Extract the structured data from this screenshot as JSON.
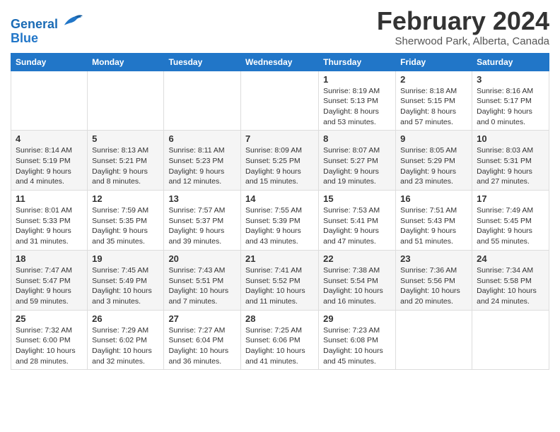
{
  "header": {
    "logo_line1": "General",
    "logo_line2": "Blue",
    "title": "February 2024",
    "subtitle": "Sherwood Park, Alberta, Canada"
  },
  "days_of_week": [
    "Sunday",
    "Monday",
    "Tuesday",
    "Wednesday",
    "Thursday",
    "Friday",
    "Saturday"
  ],
  "weeks": [
    [
      {
        "day": "",
        "info": ""
      },
      {
        "day": "",
        "info": ""
      },
      {
        "day": "",
        "info": ""
      },
      {
        "day": "",
        "info": ""
      },
      {
        "day": "1",
        "info": "Sunrise: 8:19 AM\nSunset: 5:13 PM\nDaylight: 8 hours and 53 minutes."
      },
      {
        "day": "2",
        "info": "Sunrise: 8:18 AM\nSunset: 5:15 PM\nDaylight: 8 hours and 57 minutes."
      },
      {
        "day": "3",
        "info": "Sunrise: 8:16 AM\nSunset: 5:17 PM\nDaylight: 9 hours and 0 minutes."
      }
    ],
    [
      {
        "day": "4",
        "info": "Sunrise: 8:14 AM\nSunset: 5:19 PM\nDaylight: 9 hours and 4 minutes."
      },
      {
        "day": "5",
        "info": "Sunrise: 8:13 AM\nSunset: 5:21 PM\nDaylight: 9 hours and 8 minutes."
      },
      {
        "day": "6",
        "info": "Sunrise: 8:11 AM\nSunset: 5:23 PM\nDaylight: 9 hours and 12 minutes."
      },
      {
        "day": "7",
        "info": "Sunrise: 8:09 AM\nSunset: 5:25 PM\nDaylight: 9 hours and 15 minutes."
      },
      {
        "day": "8",
        "info": "Sunrise: 8:07 AM\nSunset: 5:27 PM\nDaylight: 9 hours and 19 minutes."
      },
      {
        "day": "9",
        "info": "Sunrise: 8:05 AM\nSunset: 5:29 PM\nDaylight: 9 hours and 23 minutes."
      },
      {
        "day": "10",
        "info": "Sunrise: 8:03 AM\nSunset: 5:31 PM\nDaylight: 9 hours and 27 minutes."
      }
    ],
    [
      {
        "day": "11",
        "info": "Sunrise: 8:01 AM\nSunset: 5:33 PM\nDaylight: 9 hours and 31 minutes."
      },
      {
        "day": "12",
        "info": "Sunrise: 7:59 AM\nSunset: 5:35 PM\nDaylight: 9 hours and 35 minutes."
      },
      {
        "day": "13",
        "info": "Sunrise: 7:57 AM\nSunset: 5:37 PM\nDaylight: 9 hours and 39 minutes."
      },
      {
        "day": "14",
        "info": "Sunrise: 7:55 AM\nSunset: 5:39 PM\nDaylight: 9 hours and 43 minutes."
      },
      {
        "day": "15",
        "info": "Sunrise: 7:53 AM\nSunset: 5:41 PM\nDaylight: 9 hours and 47 minutes."
      },
      {
        "day": "16",
        "info": "Sunrise: 7:51 AM\nSunset: 5:43 PM\nDaylight: 9 hours and 51 minutes."
      },
      {
        "day": "17",
        "info": "Sunrise: 7:49 AM\nSunset: 5:45 PM\nDaylight: 9 hours and 55 minutes."
      }
    ],
    [
      {
        "day": "18",
        "info": "Sunrise: 7:47 AM\nSunset: 5:47 PM\nDaylight: 9 hours and 59 minutes."
      },
      {
        "day": "19",
        "info": "Sunrise: 7:45 AM\nSunset: 5:49 PM\nDaylight: 10 hours and 3 minutes."
      },
      {
        "day": "20",
        "info": "Sunrise: 7:43 AM\nSunset: 5:51 PM\nDaylight: 10 hours and 7 minutes."
      },
      {
        "day": "21",
        "info": "Sunrise: 7:41 AM\nSunset: 5:52 PM\nDaylight: 10 hours and 11 minutes."
      },
      {
        "day": "22",
        "info": "Sunrise: 7:38 AM\nSunset: 5:54 PM\nDaylight: 10 hours and 16 minutes."
      },
      {
        "day": "23",
        "info": "Sunrise: 7:36 AM\nSunset: 5:56 PM\nDaylight: 10 hours and 20 minutes."
      },
      {
        "day": "24",
        "info": "Sunrise: 7:34 AM\nSunset: 5:58 PM\nDaylight: 10 hours and 24 minutes."
      }
    ],
    [
      {
        "day": "25",
        "info": "Sunrise: 7:32 AM\nSunset: 6:00 PM\nDaylight: 10 hours and 28 minutes."
      },
      {
        "day": "26",
        "info": "Sunrise: 7:29 AM\nSunset: 6:02 PM\nDaylight: 10 hours and 32 minutes."
      },
      {
        "day": "27",
        "info": "Sunrise: 7:27 AM\nSunset: 6:04 PM\nDaylight: 10 hours and 36 minutes."
      },
      {
        "day": "28",
        "info": "Sunrise: 7:25 AM\nSunset: 6:06 PM\nDaylight: 10 hours and 41 minutes."
      },
      {
        "day": "29",
        "info": "Sunrise: 7:23 AM\nSunset: 6:08 PM\nDaylight: 10 hours and 45 minutes."
      },
      {
        "day": "",
        "info": ""
      },
      {
        "day": "",
        "info": ""
      }
    ]
  ]
}
